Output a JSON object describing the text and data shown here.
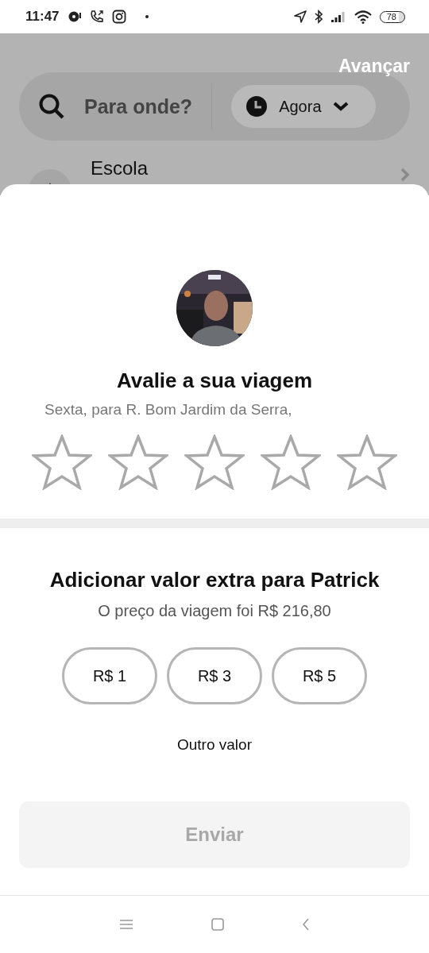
{
  "status_bar": {
    "time": "11:47",
    "battery": "78"
  },
  "backdrop": {
    "action": "Avançar",
    "search_placeholder": "Para onde?",
    "time_choice": "Agora",
    "saved_place": "Escola"
  },
  "rating": {
    "title": "Avalie a sua viagem",
    "subtitle": "Sexta, para R. Bom Jardim da Serra,",
    "stars": 0
  },
  "tip": {
    "title": "Adicionar valor extra para Patrick",
    "subtitle": "O preço da viagem foi R$ 216,80",
    "options": [
      {
        "label": "R$ 1",
        "selected": false
      },
      {
        "label": "R$ 3",
        "selected": false
      },
      {
        "label": "R$ 5",
        "selected": false
      }
    ],
    "other": "Outro valor"
  },
  "submit": {
    "label": "Enviar",
    "disabled": true
  }
}
